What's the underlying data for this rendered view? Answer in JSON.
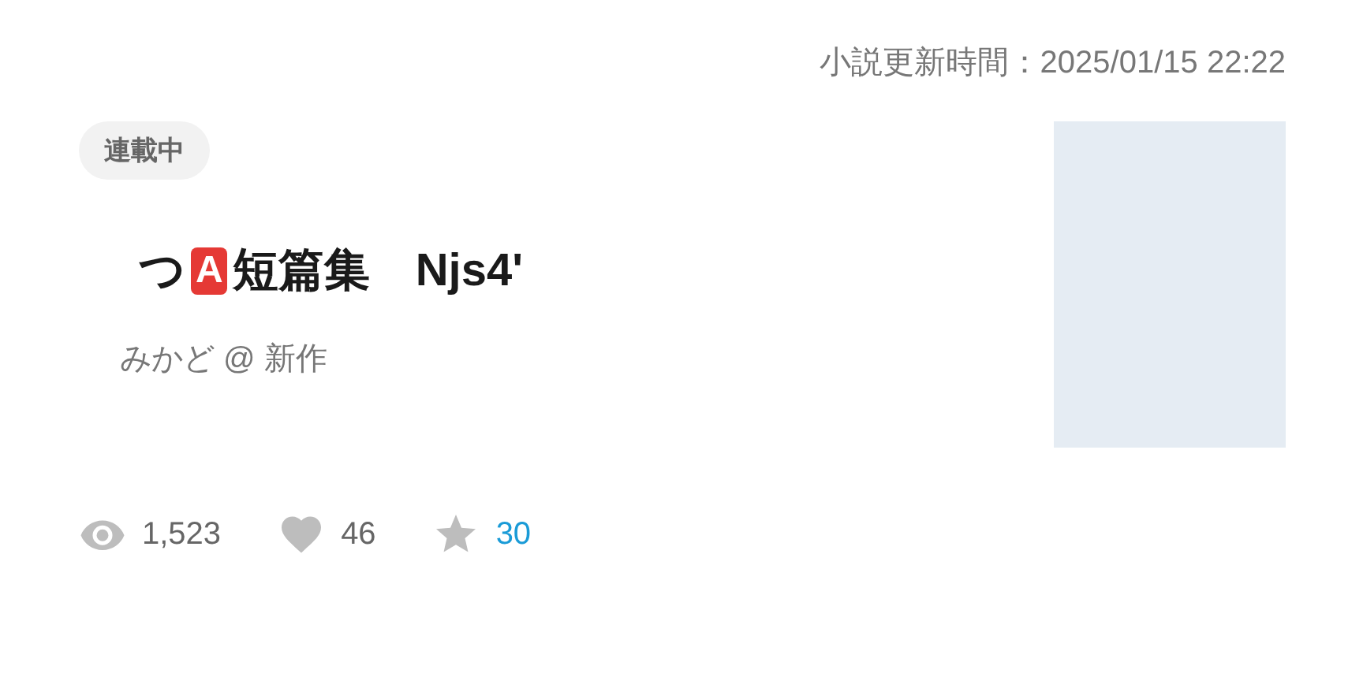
{
  "updated": "小説更新時間：2025/01/15 22:22",
  "status_tag": "連載中",
  "title": [
    {
      "kind": "text",
      "text": "つ"
    },
    {
      "kind": "badge",
      "text": "A"
    },
    {
      "kind": "text",
      "text": "短篇集　Njs4'"
    }
  ],
  "author": "みかど @ 新作",
  "stats": [
    {
      "kind": "views",
      "text": "1,523",
      "color": "#666666"
    },
    {
      "kind": "likes",
      "text": "46",
      "color": "#666666"
    },
    {
      "kind": "bookmarks",
      "text": "30",
      "color": "#1a9bd7"
    }
  ]
}
